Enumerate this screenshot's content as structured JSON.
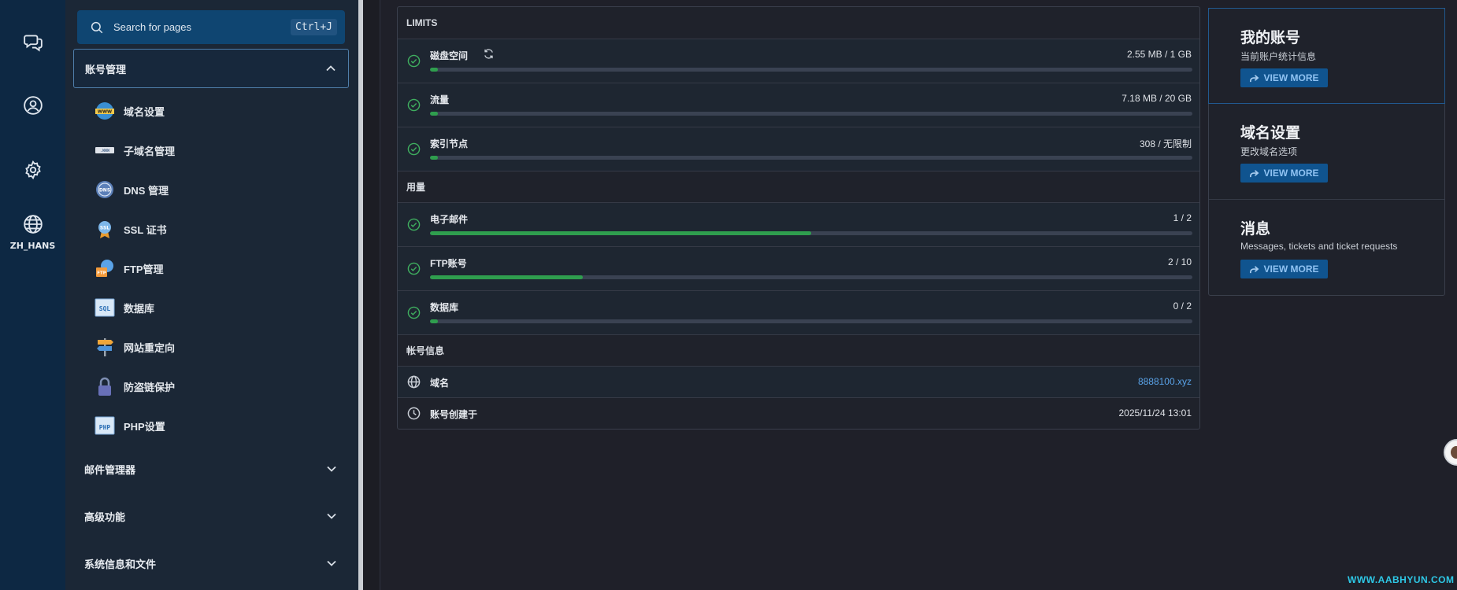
{
  "rail": {
    "items": [
      {
        "icon": "chat-icon",
        "label": ""
      },
      {
        "icon": "account-icon",
        "label": ""
      },
      {
        "icon": "gear-icon",
        "label": ""
      },
      {
        "icon": "globe-icon",
        "label": "ZH_HANS"
      }
    ]
  },
  "search": {
    "placeholder": "Search for pages",
    "shortcut": "Ctrl+J"
  },
  "sidebar": {
    "open_group": "账号管理",
    "items": [
      {
        "label": "域名设置",
        "icon": "www-icon"
      },
      {
        "label": "子域名管理",
        "icon": "subdomain-icon"
      },
      {
        "label": "DNS 管理",
        "icon": "dns-icon"
      },
      {
        "label": "SSL 证书",
        "icon": "ssl-certificate-icon"
      },
      {
        "label": "FTP管理",
        "icon": "ftp-icon"
      },
      {
        "label": "数据库",
        "icon": "sql-database-icon"
      },
      {
        "label": "网站重定向",
        "icon": "signpost-icon"
      },
      {
        "label": "防盗链保护",
        "icon": "lock-icon"
      },
      {
        "label": "PHP设置",
        "icon": "php-icon"
      }
    ],
    "groups": [
      "邮件管理器",
      "高级功能",
      "系统信息和文件"
    ]
  },
  "limits": {
    "header": "LIMITS",
    "rows": [
      {
        "name": "磁盘空间",
        "value": "2.55 MB / 1 GB",
        "fill": 0.01,
        "refresh": true
      },
      {
        "name": "流量",
        "value": "7.18 MB / 20 GB",
        "fill": 0.01
      },
      {
        "name": "索引节点",
        "value": "308 / 无限制",
        "fill": 0.01
      }
    ]
  },
  "usage": {
    "header": "用量",
    "rows": [
      {
        "name": "电子邮件",
        "value": "1 / 2",
        "fill": 0.5
      },
      {
        "name": "FTP账号",
        "value": "2 / 10",
        "fill": 0.2
      },
      {
        "name": "数据库",
        "value": "0 / 2",
        "fill": 0.01
      }
    ]
  },
  "account_info": {
    "header": "帐号信息",
    "domain_label": "域名",
    "domain_value": "8888100.xyz",
    "created_label": "账号创建于",
    "created_value": "2025/11/24 13:01"
  },
  "cards": [
    {
      "title": "我的账号",
      "subtitle": "当前账户统计信息",
      "button": "VIEW MORE"
    },
    {
      "title": "域名设置",
      "subtitle": "更改域名选项",
      "button": "VIEW MORE"
    },
    {
      "title": "消息",
      "subtitle": "Messages, tickets and ticket requests",
      "button": "VIEW MORE"
    }
  ],
  "watermark": "WWW.AABHYUN.COM",
  "colors": {
    "accent": "#10548f",
    "progress": "#2f9e4e",
    "rail": "#0d2843",
    "link": "#5aa3e8"
  }
}
